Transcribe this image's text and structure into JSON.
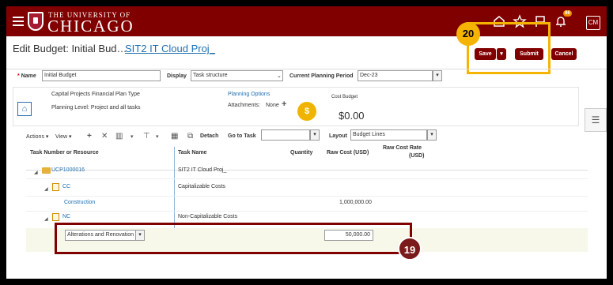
{
  "header": {
    "hamburger_icon": "menu-icon",
    "logo_top": "THE UNIVERSITY OF",
    "logo_bottom": "CHICAGO",
    "icons": [
      "home-icon",
      "star-icon",
      "flag-icon",
      "bell-icon"
    ],
    "notification_count": "86",
    "avatar_initials": "CM"
  },
  "page": {
    "title_label": "Edit Budget: Initial Bud…",
    "title_link": "SIT2 IT Cloud Proj_",
    "buttons": {
      "save": "Save",
      "submit": "Submit",
      "cancel": "Cancel"
    },
    "steps": {
      "save_step": "20",
      "row_step": "19"
    }
  },
  "form": {
    "name_label": "Name",
    "name_value": "Initial Budget",
    "display_label": "Display",
    "display_value": "Task structure",
    "period_label": "Current Planning Period",
    "period_value": "Dec-23"
  },
  "info": {
    "plan_type": "Capital Projects Financial Plan Type",
    "planning_level": "Planning Level: Project and all tasks",
    "planning_options": "Planning Options",
    "attachments_label": "Attachments:",
    "attachments_value": "None",
    "cost_budget_label": "Cost Budget",
    "cost_budget_value": "$0.00"
  },
  "toolbar": {
    "actions": "Actions",
    "view": "View",
    "detach": "Detach",
    "go_to_task": "Go to Task",
    "layout_label": "Layout",
    "layout_value": "Budget Lines"
  },
  "table": {
    "headers": {
      "task_number": "Task Number or Resource",
      "task_name": "Task Name",
      "quantity": "Quantity",
      "raw_cost": "Raw Cost (USD)",
      "raw_cost_rate_1": "Raw Cost Rate",
      "raw_cost_rate_2": "(USD)"
    },
    "rows": [
      {
        "number": "UCP1000016",
        "name": "SIT2 IT Cloud Proj_",
        "raw_cost": ""
      },
      {
        "number": "CC",
        "name": "Capitalizable Costs",
        "raw_cost": ""
      },
      {
        "number": "Construction",
        "name": "",
        "raw_cost": "1,000,000.00"
      },
      {
        "number": "NC",
        "name": "Non-Capitalizable Costs",
        "raw_cost": ""
      },
      {
        "number": "Alterations and Renovation",
        "name": "",
        "raw_cost": "50,000.00"
      }
    ]
  }
}
